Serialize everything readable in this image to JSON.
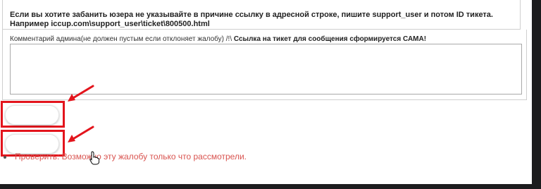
{
  "info": {
    "text": "Если вы хотите забанить юзера не указывайте в причине ссылку в адресной строке, пишите support_user и потом ID тикета. Например iccup.com\\support_user\\ticket\\800500.html"
  },
  "form": {
    "comment_label": "Комментарий админа(не должен пустым если отклоняет жалобу) /!\\ ",
    "comment_label_bold": "Ссылка на тикет для сообщения сформируется САМА!",
    "comment_value": ""
  },
  "buttons": {
    "first_label": "",
    "second_label": ""
  },
  "status": {
    "text": "Проверить: Возможно эту жалобу только что рассмотрели."
  },
  "colors": {
    "highlight": "#e3141c",
    "status_text": "#d9534f",
    "background_outside": "#1c1c1e"
  },
  "icons": [
    "arrow-icon",
    "hand-cursor-icon",
    "resize-handle-icon"
  ]
}
